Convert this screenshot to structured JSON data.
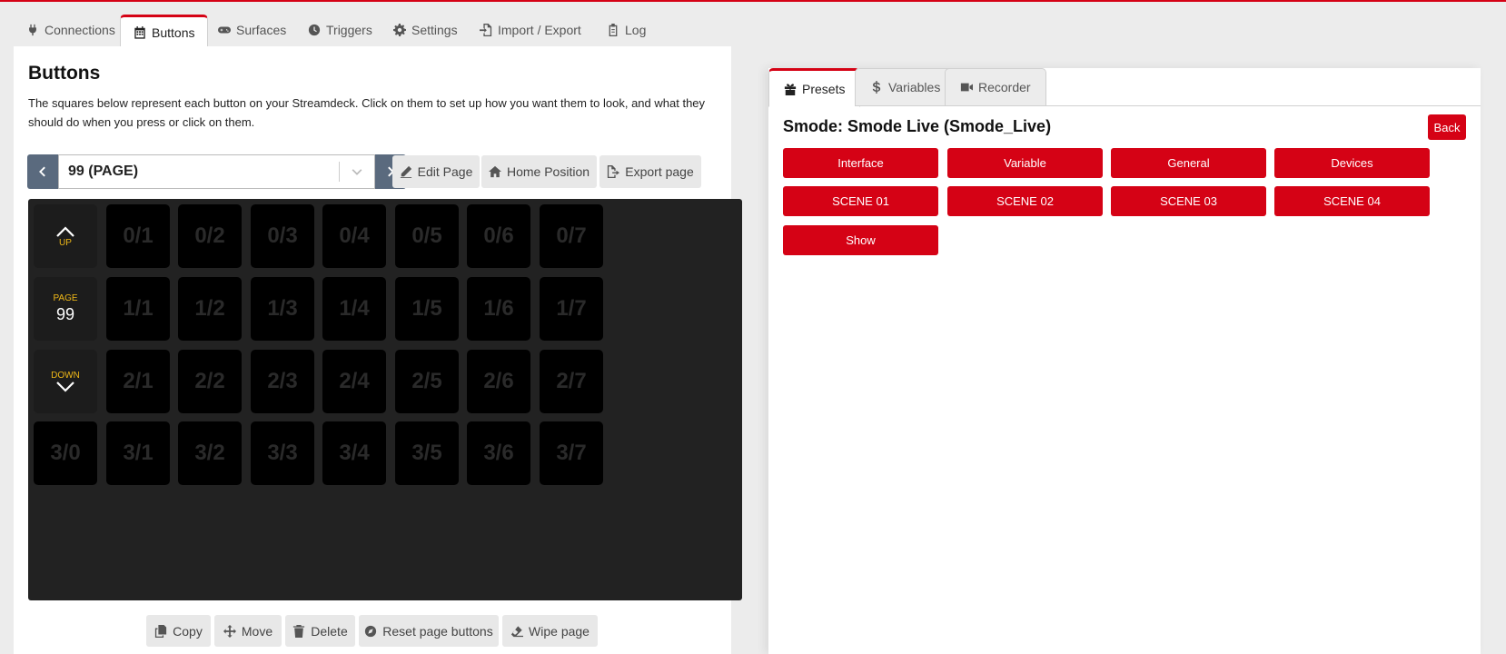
{
  "colors": {
    "accent": "#d50215",
    "grid_bg": "#222222",
    "button_bg": "#000000",
    "nav_label": "#f0b818"
  },
  "nav": {
    "tabs": [
      {
        "label": "Connections",
        "icon": "plug-icon"
      },
      {
        "label": "Buttons",
        "icon": "calendar-grid-icon"
      },
      {
        "label": "Surfaces",
        "icon": "gamepad-icon"
      },
      {
        "label": "Triggers",
        "icon": "clock-icon"
      },
      {
        "label": "Settings",
        "icon": "gear-icon"
      },
      {
        "label": "Import / Export",
        "icon": "file-import-icon"
      },
      {
        "label": "Log",
        "icon": "clipboard-icon"
      }
    ],
    "active": "Buttons"
  },
  "buttons_page": {
    "title": "Buttons",
    "description": "The squares below represent each button on your Streamdeck. Click on them to set up how you want them to look, and what they should do when you press or click on them.",
    "page_select_value": "99 (PAGE)",
    "edit_page": "Edit Page",
    "home_position": "Home Position",
    "export_page": "Export page"
  },
  "grid": {
    "nav_up_label": "UP",
    "nav_page_label": "PAGE",
    "nav_page_number": "99",
    "nav_down_label": "DOWN",
    "rows": [
      [
        "",
        "0/1",
        "0/2",
        "0/3",
        "0/4",
        "0/5",
        "0/6",
        "0/7"
      ],
      [
        "",
        "1/1",
        "1/2",
        "1/3",
        "1/4",
        "1/5",
        "1/6",
        "1/7"
      ],
      [
        "",
        "2/1",
        "2/2",
        "2/3",
        "2/4",
        "2/5",
        "2/6",
        "2/7"
      ],
      [
        "3/0",
        "3/1",
        "3/2",
        "3/3",
        "3/4",
        "3/5",
        "3/6",
        "3/7"
      ]
    ]
  },
  "bottom_actions": {
    "copy": "Copy",
    "move": "Move",
    "delete": "Delete",
    "reset": "Reset page buttons",
    "wipe": "Wipe page"
  },
  "right": {
    "tabs": [
      {
        "label": "Presets",
        "icon": "gift-icon"
      },
      {
        "label": "Variables",
        "icon": "dollar-icon"
      },
      {
        "label": "Recorder",
        "icon": "video-camera-icon"
      }
    ],
    "active_tab": "Presets",
    "preset_title": "Smode: Smode Live (Smode_Live)",
    "back_label": "Back",
    "preset_buttons": [
      "Interface",
      "Variable",
      "General",
      "Devices",
      "SCENE 01",
      "SCENE 02",
      "SCENE 03",
      "SCENE 04",
      "Show"
    ]
  }
}
